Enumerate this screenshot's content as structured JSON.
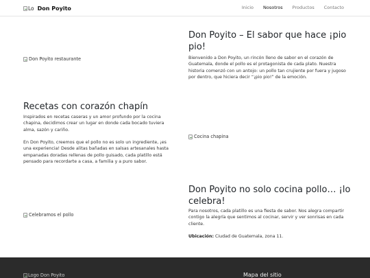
{
  "navbar": {
    "logo_alt": "Lo",
    "brand": "Don Poyito",
    "links": [
      "Inicio",
      "Nosotros",
      "Productos",
      "Contacto"
    ],
    "active": "Nosotros"
  },
  "section1": {
    "image_alt": "Don Poyito restaurante",
    "title": "Don Poyito – El sabor que hace ¡pio pio!",
    "paragraph": "Bienvenido a Don Poyito, un rincón lleno de sabor en el corazón de Guatemala, donde el pollo es el protagonista de cada plato. Nuestra historia comenzó con un antojo: un pollo tan crujiente por fuera y jugoso por dentro, que hiciera decir “¡pio pio!” de la emoción."
  },
  "section2": {
    "title": "Recetas con corazón chapín",
    "paragraph1": "Inspirados en recetas caseras y un amor profundo por la cocina chapina, decidimos crear un lugar en donde cada bocado tuviera alma, sazón y cariño.",
    "paragraph2": "En Don Poyito, creemos que el pollo no es solo un ingrediente, ¡es una experiencia! Desde alitas bañadas en salsas artesanales hasta empanadas doradas rellenas de pollo guisado, cada platillo está pensado para recordarte a casa, a familia y a puro sabor.",
    "image_alt": "Cocina chapina"
  },
  "section3": {
    "image_alt": "Celebramos el pollo",
    "title": "Don Poyito no solo cocina pollo… ¡lo celebra!",
    "paragraph": "Para nosotros, cada platillo es una fiesta de sabor. Nos alegra compartir contigo la alegría que sentimos al cocinar, servir y ver sonrisas en cada cliente.",
    "location_label": "Ubicación:",
    "location_value": "Ciudad de Guatemala, zona 11."
  },
  "footer": {
    "logo_alt": "Logo Don Poyito",
    "sitemap_title": "Mapa del sitio"
  }
}
